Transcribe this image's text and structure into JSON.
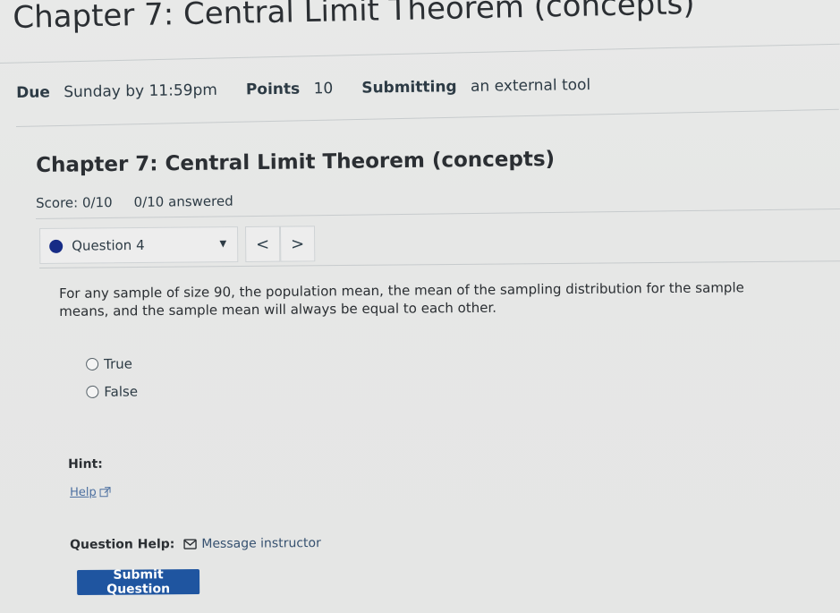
{
  "header": {
    "title": "Chapter 7: Central Limit Theorem (concepts)"
  },
  "assignment_meta": {
    "due_label": "Due",
    "due_value": "Sunday by 11:59pm",
    "points_label": "Points",
    "points_value": "10",
    "submitting_label": "Submitting",
    "submitting_value": "an external tool"
  },
  "quiz": {
    "title": "Chapter 7: Central Limit Theorem (concepts)",
    "score": "Score: 0/10",
    "answered": "0/10 answered",
    "current_question": "Question 4",
    "prev_label": "<",
    "next_label": ">",
    "question_text": "For any sample of size 90, the population mean, the mean of the sampling distribution for the sample means, and the sample mean will always be equal to each other.",
    "choices": [
      {
        "label": "True"
      },
      {
        "label": "False"
      }
    ],
    "hint_label": "Hint:",
    "help_link": "Help",
    "question_help_label": "Question Help:",
    "message_instructor": "Message instructor",
    "submit_label": "Submit Question"
  },
  "colors": {
    "background": "#e6e7e6",
    "text": "#2b2f33",
    "primary_button": "#1f55a0",
    "question_indicator": "#172c86",
    "link": "#4c6fa0"
  },
  "icons": {
    "question_indicator": "filled-circle-icon",
    "dropdown": "caret-down-icon",
    "previous": "chevron-left-icon",
    "next": "chevron-right-icon",
    "external_link": "external-link-icon",
    "message": "mail-icon"
  }
}
